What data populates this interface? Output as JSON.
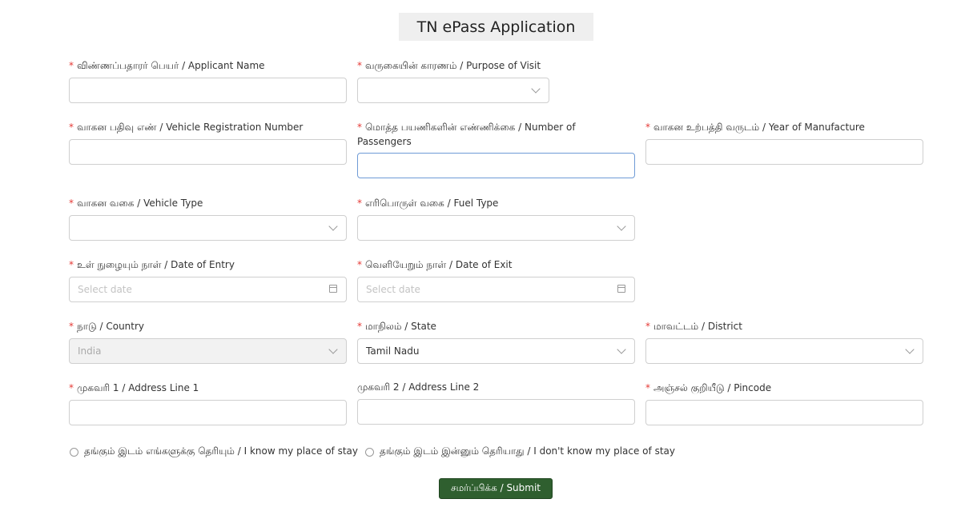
{
  "title": "TN ePass Application",
  "required_mark": "*",
  "fields": {
    "applicant_name": {
      "label": "விண்ணப்பதாரர் பெயர் / Applicant Name",
      "value": ""
    },
    "purpose": {
      "label": "வருகையின் காரணம் / Purpose of Visit",
      "value": ""
    },
    "vehicle_reg": {
      "label": "வாகன பதிவு எண் / Vehicle Registration Number",
      "value": ""
    },
    "passengers": {
      "label": "மொத்த பயணிகளின் எண்ணிக்கை / Number of Passengers",
      "value": ""
    },
    "year": {
      "label": "வாகன உற்பத்தி வருடம் / Year of Manufacture",
      "value": ""
    },
    "vehicle_type": {
      "label": "வாகன வகை / Vehicle Type",
      "value": ""
    },
    "fuel_type": {
      "label": "எரிபொருள் வகை / Fuel Type",
      "value": ""
    },
    "date_entry": {
      "label": "உள் நுழையும் நாள் / Date of Entry",
      "placeholder": "Select date"
    },
    "date_exit": {
      "label": "வெளியேறும் நாள் / Date of Exit",
      "placeholder": "Select date"
    },
    "country": {
      "label": "நாடு / Country",
      "value": "India"
    },
    "state": {
      "label": "மாநிலம் / State",
      "value": "Tamil Nadu"
    },
    "district": {
      "label": "மாவட்டம் / District",
      "value": ""
    },
    "address1": {
      "label": "முகவரி 1 / Address Line 1",
      "value": ""
    },
    "address2": {
      "label": "முகவரி 2 / Address Line 2",
      "value": ""
    },
    "pincode": {
      "label": "அஞ்சல் குறியீடு / Pincode",
      "value": ""
    }
  },
  "stay_options": [
    "தங்கும் இடம் எங்களுக்கு தெரியும் / I know my place of stay",
    "தங்கும் இடம் இன்னும் தெரியாது / I don't know my place of stay"
  ],
  "submit_label": "சமர்ப்பிக்க / Submit",
  "icons": {
    "dropdown": "chevron-down-icon",
    "calendar": "calendar-icon"
  }
}
